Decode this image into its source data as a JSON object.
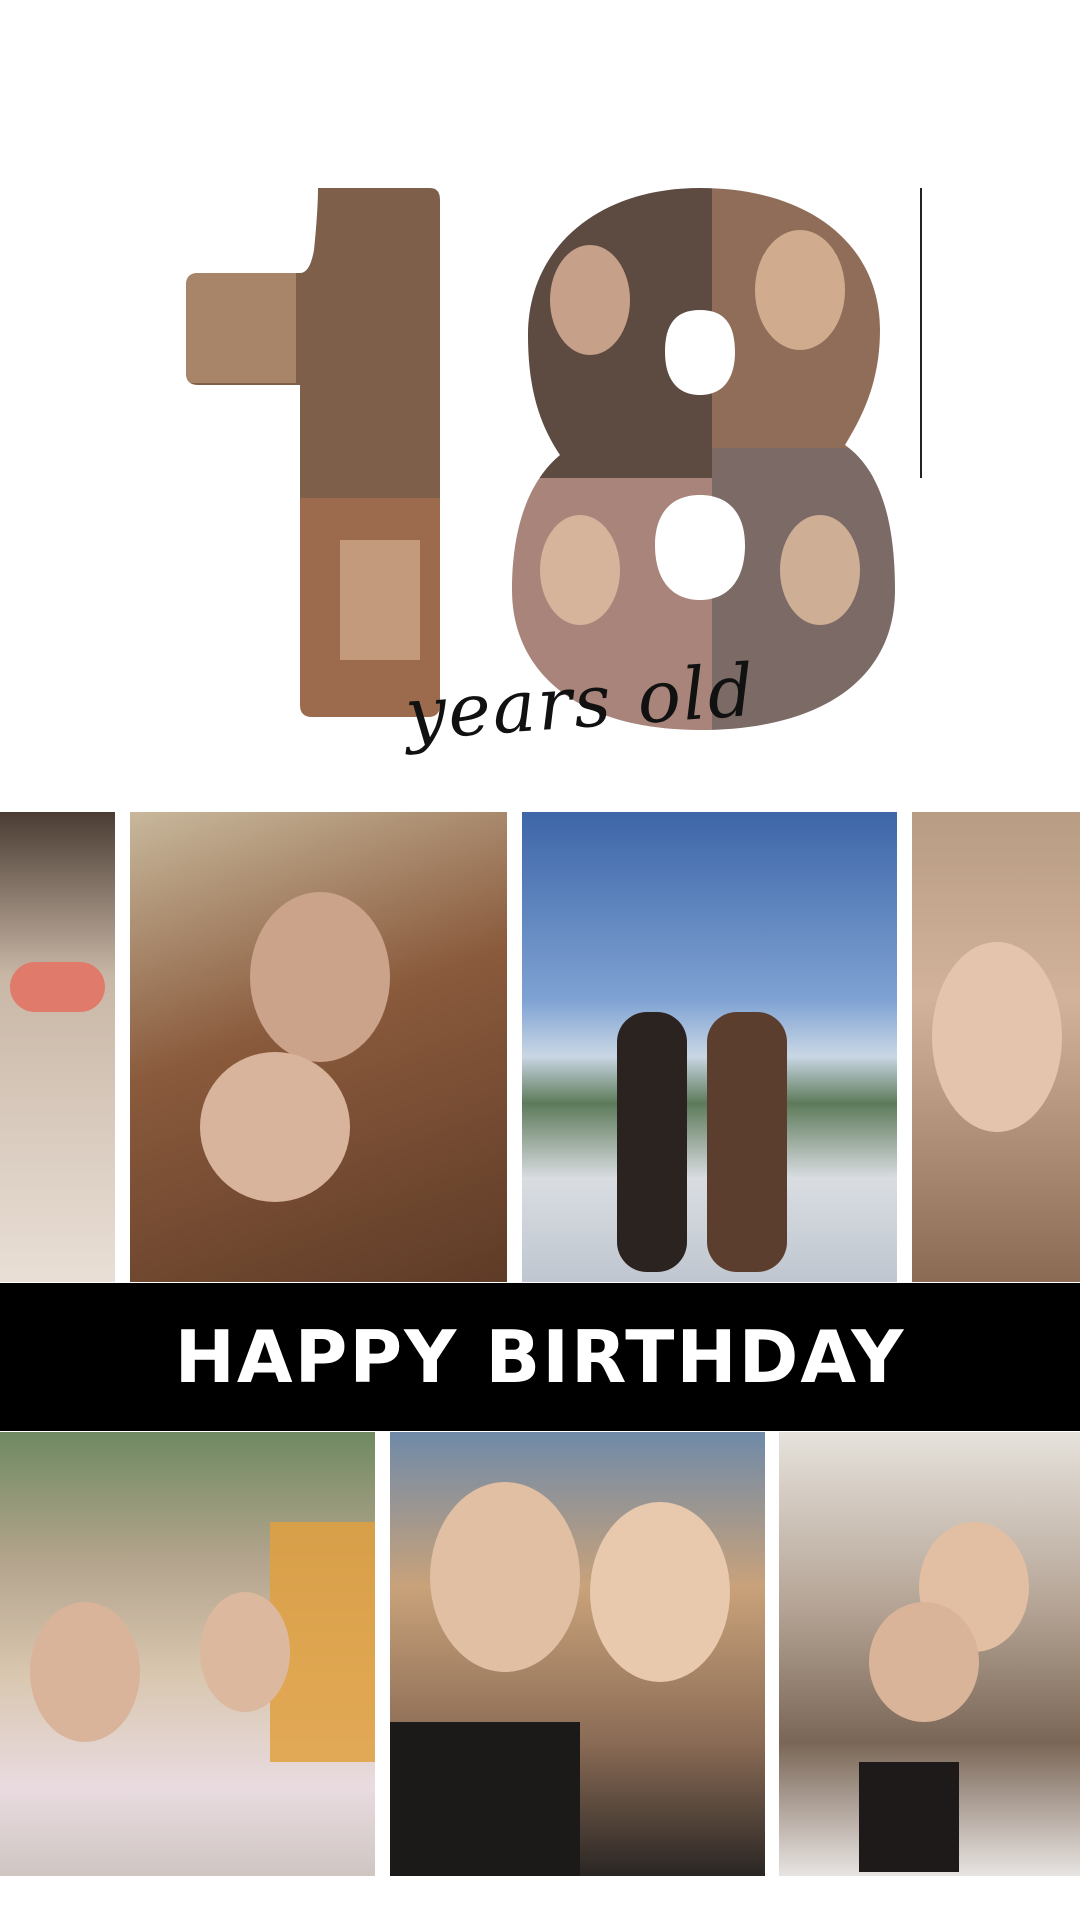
{
  "hero": {
    "number": "18",
    "subtitle": "years old"
  },
  "banner": {
    "text": "HAPPY BIRTHDAY"
  },
  "colors": {
    "banner_bg": "#000000",
    "banner_text": "#ffffff",
    "background": "#ffffff"
  },
  "photos_top_row": [
    {
      "name": "photo-heart-sunglasses",
      "tone": "#c9b7a6"
    },
    {
      "name": "photo-two-girls-hug",
      "tone": "#8a5a3c"
    },
    {
      "name": "photo-lake-terrace",
      "tone": "#6f93c4"
    },
    {
      "name": "photo-pout-selfie",
      "tone": "#d2b29a"
    }
  ],
  "photos_bottom_row": [
    {
      "name": "photo-ice-cream-street",
      "tone": "#b98f6e"
    },
    {
      "name": "photo-two-friends-sun",
      "tone": "#c9a27a"
    },
    {
      "name": "photo-indoor-hug",
      "tone": "#b4a394"
    }
  ]
}
